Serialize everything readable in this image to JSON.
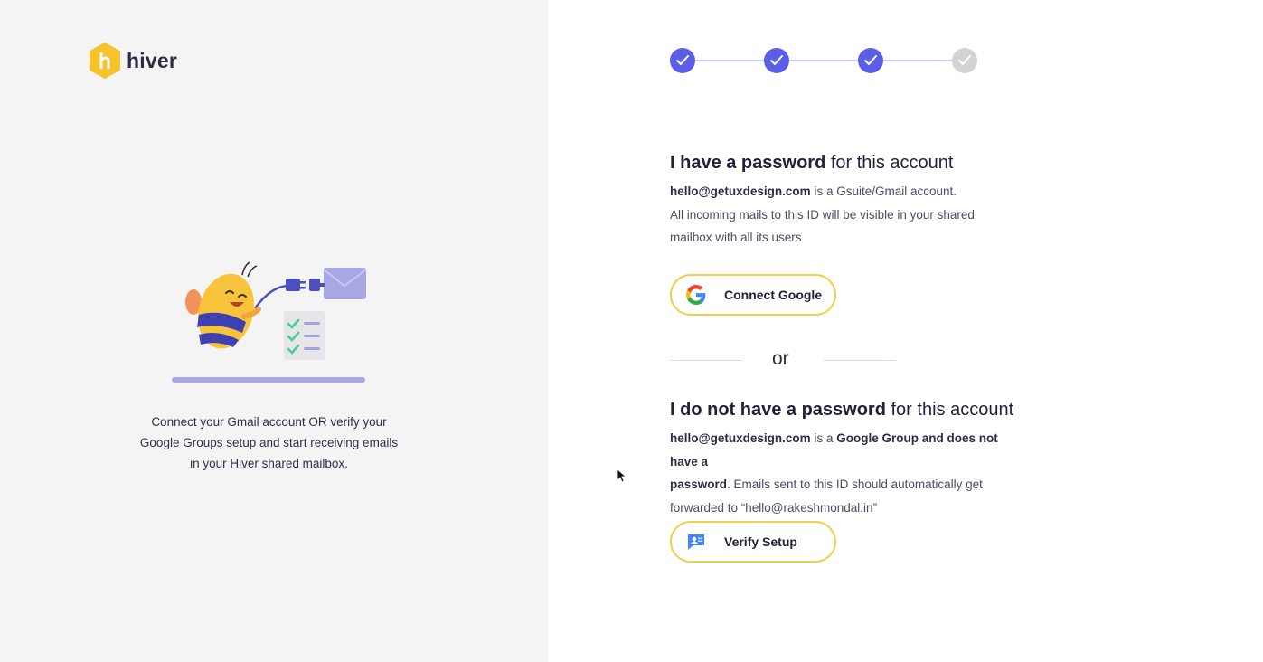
{
  "brand": {
    "name": "hiver",
    "color": "#f6c32c"
  },
  "left_panel": {
    "tagline_lines": [
      "Connect your Gmail account OR verify your",
      "Google Groups setup and start receiving emails",
      "in your Hiver shared mailbox."
    ]
  },
  "stepper": {
    "steps": [
      {
        "state": "done"
      },
      {
        "state": "done"
      },
      {
        "state": "done"
      },
      {
        "state": "pending"
      }
    ],
    "colors": {
      "done": "#5b5fe8",
      "pending": "#d3d3d6"
    }
  },
  "password_section": {
    "title_bold": "I have a password",
    "title_rest": " for this account",
    "email": "hello@getuxdesign.com",
    "line1_rest": " is a Gsuite/Gmail account.",
    "line2": "All incoming mails to this ID will be visible in your shared",
    "line3": "mailbox with all its users",
    "button_label": "Connect Google",
    "button_icon": "google-icon"
  },
  "divider": {
    "label": "or"
  },
  "no_password_section": {
    "title_bold": "I do not have a password",
    "title_rest": " for this account",
    "email": "hello@getuxdesign.com",
    "line1_mid": " is a ",
    "line1_bold": "Google Group and does not have a",
    "line2_bold": "password",
    "line2_rest": ". Emails sent to this ID should automatically get",
    "line3": "forwarded to “hello@rakeshmondal.in”",
    "button_label": "Verify Setup",
    "button_icon": "google-groups-icon"
  },
  "accent_colors": {
    "button_border": "#f2cf49",
    "illustration_base": "#a9a6e6"
  }
}
